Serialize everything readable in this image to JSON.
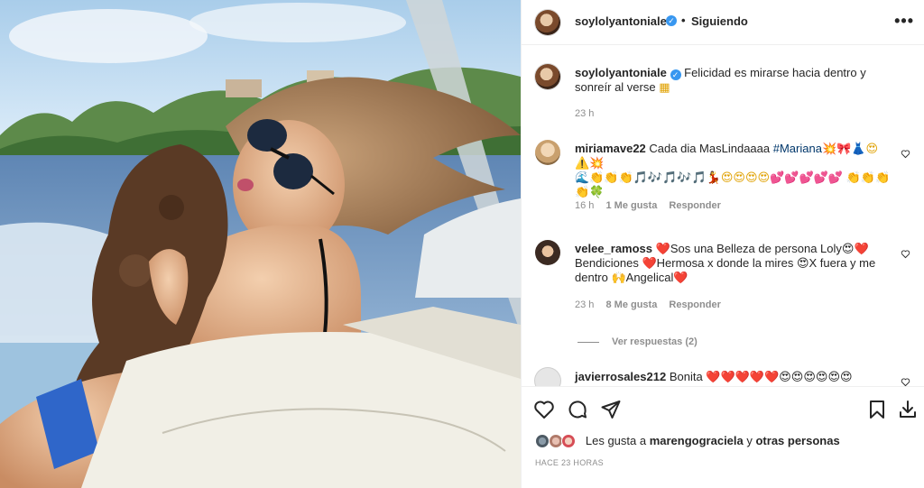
{
  "post": {
    "username": "soylolyantoniale",
    "verified_badge": "✓",
    "separator": "•",
    "follow_status": "Siguiendo",
    "more_icon": "more-horizontal-icon"
  },
  "caption": {
    "username": "soylolyantoniale",
    "text": "Felicidad es mirarse hacia dentro y sonreír al verse",
    "time": "23 h"
  },
  "comments": [
    {
      "username": "miriamave22",
      "text_before": "Cada dia MasLindaaaa ",
      "hashtag": "#Mariana",
      "emoji_line_1": "💥🎀👗😍⚠️💥",
      "emoji_line_2": "🌊👏👏👏🎵🎶🎵🎶🎵💃😍😍😍😍💕💕💕💕💕 👏👏👏",
      "emoji_line_3": "👏🍀",
      "time": "16 h",
      "likes": "1 Me gusta",
      "reply": "Responder"
    },
    {
      "username": "velee_ramoss",
      "text": "❤️Sos una Belleza de persona Loly😍❤️ Bendiciones ❤️Hermosa x donde la mires 😍X fuera y me dentro 🙌Angelical❤️",
      "time": "23 h",
      "likes": "8 Me gusta",
      "reply": "Responder"
    },
    {
      "username": "javierrosales212",
      "text": "Bonita ❤️❤️❤️❤️❤️😍😍😍😍😍😍"
    }
  ],
  "view_replies": "Ver respuestas (2)",
  "likes_line": {
    "prefix": "Les gusta a ",
    "user": "marengograciela",
    "middle": " y ",
    "others": "otras personas"
  },
  "timestamp": "HACE 23 HORAS",
  "colors": {
    "link": "#00376b",
    "verified": "#3897f0",
    "muted": "#8e8e8e",
    "text": "#262626"
  }
}
